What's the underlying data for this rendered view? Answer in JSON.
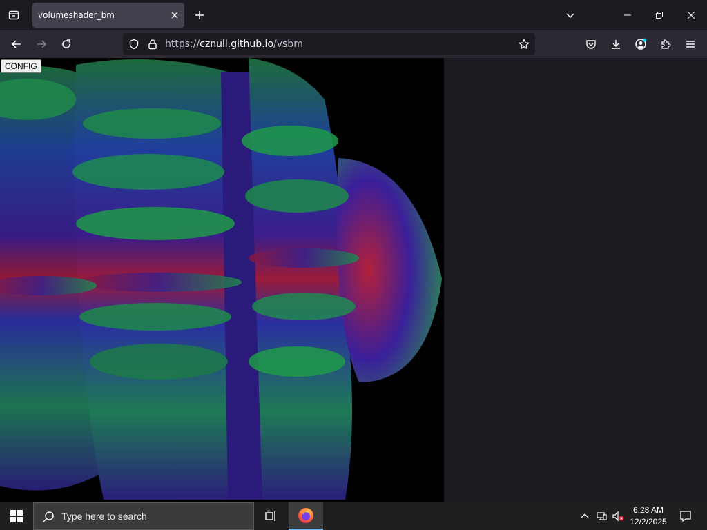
{
  "browser": {
    "tab": {
      "title": "volumeshader_bm"
    },
    "url": {
      "scheme": "https://",
      "host": "cznull.github.io",
      "path": "/vsbm"
    }
  },
  "page": {
    "config_label": "CONFIG"
  },
  "taskbar": {
    "search_placeholder": "Type here to search",
    "time": "6:28 AM",
    "date": "12/2/2025"
  },
  "colors": {
    "tab_active": "#42414d",
    "navbar": "#2b2a33",
    "urlbar": "#1c1b22",
    "accent_blue": "#00ddff"
  }
}
